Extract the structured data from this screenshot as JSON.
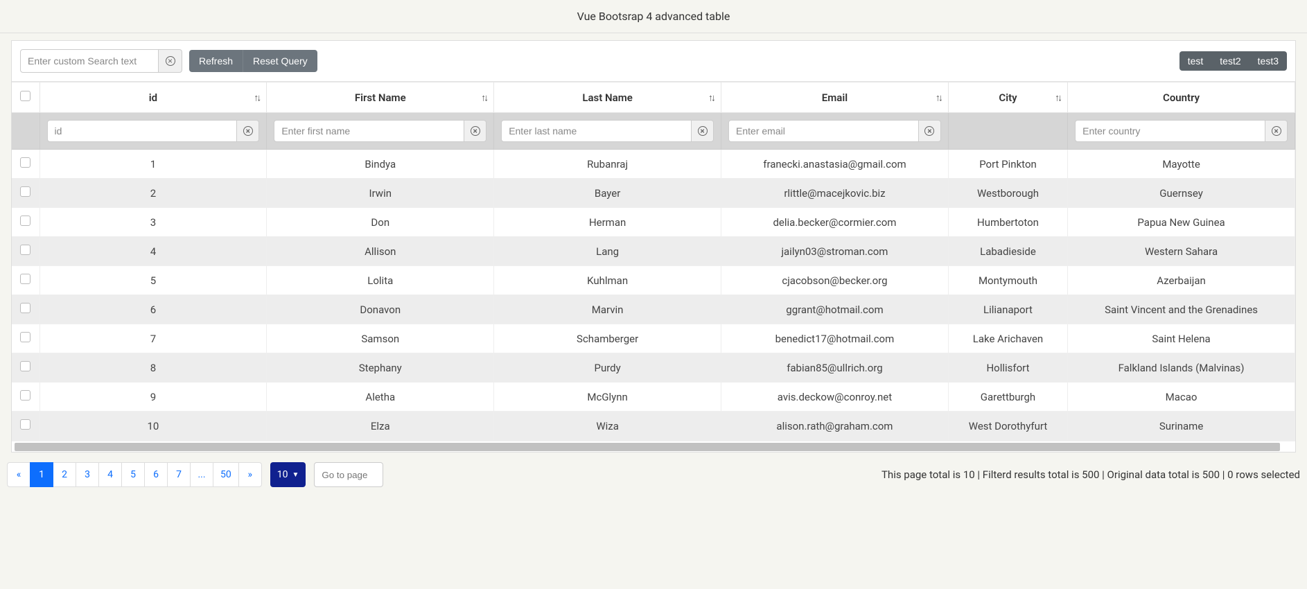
{
  "page_title": "Vue Bootsrap 4 advanced table",
  "toolbar": {
    "search_placeholder": "Enter custom Search text",
    "refresh_label": "Refresh",
    "reset_query_label": "Reset Query",
    "right_buttons": [
      "test",
      "test2",
      "test3"
    ]
  },
  "columns": [
    {
      "label": "id",
      "sortable": true,
      "filter_placeholder": "id"
    },
    {
      "label": "First Name",
      "sortable": true,
      "filter_placeholder": "Enter first name"
    },
    {
      "label": "Last Name",
      "sortable": true,
      "filter_placeholder": "Enter last name"
    },
    {
      "label": "Email",
      "sortable": true,
      "filter_placeholder": "Enter email"
    },
    {
      "label": "City",
      "sortable": true,
      "filter_placeholder": ""
    },
    {
      "label": "Country",
      "sortable": false,
      "filter_placeholder": "Enter country"
    }
  ],
  "rows": [
    {
      "id": "1",
      "first_name": "Bindya",
      "last_name": "Rubanraj",
      "email": "franecki.anastasia@gmail.com",
      "city": "Port Pinkton",
      "country": "Mayotte"
    },
    {
      "id": "2",
      "first_name": "Irwin",
      "last_name": "Bayer",
      "email": "rlittle@macejkovic.biz",
      "city": "Westborough",
      "country": "Guernsey"
    },
    {
      "id": "3",
      "first_name": "Don",
      "last_name": "Herman",
      "email": "delia.becker@cormier.com",
      "city": "Humbertoton",
      "country": "Papua New Guinea"
    },
    {
      "id": "4",
      "first_name": "Allison",
      "last_name": "Lang",
      "email": "jailyn03@stroman.com",
      "city": "Labadieside",
      "country": "Western Sahara"
    },
    {
      "id": "5",
      "first_name": "Lolita",
      "last_name": "Kuhlman",
      "email": "cjacobson@becker.org",
      "city": "Montymouth",
      "country": "Azerbaijan"
    },
    {
      "id": "6",
      "first_name": "Donavon",
      "last_name": "Marvin",
      "email": "ggrant@hotmail.com",
      "city": "Lilianaport",
      "country": "Saint Vincent and the Grenadines"
    },
    {
      "id": "7",
      "first_name": "Samson",
      "last_name": "Schamberger",
      "email": "benedict17@hotmail.com",
      "city": "Lake Arichaven",
      "country": "Saint Helena"
    },
    {
      "id": "8",
      "first_name": "Stephany",
      "last_name": "Purdy",
      "email": "fabian85@ullrich.org",
      "city": "Hollisfort",
      "country": "Falkland Islands (Malvinas)"
    },
    {
      "id": "9",
      "first_name": "Aletha",
      "last_name": "McGlynn",
      "email": "avis.deckow@conroy.net",
      "city": "Garettburgh",
      "country": "Macao"
    },
    {
      "id": "10",
      "first_name": "Elza",
      "last_name": "Wiza",
      "email": "alison.rath@graham.com",
      "city": "West Dorothyfurt",
      "country": "Suriname"
    }
  ],
  "pagination": {
    "prev": "«",
    "next": "»",
    "items": [
      "1",
      "2",
      "3",
      "4",
      "5",
      "6",
      "7",
      "...",
      "50"
    ],
    "active_index": 0,
    "per_page_label": "10",
    "goto_placeholder": "Go to page"
  },
  "footer_status": "This page total is 10 | Filterd results total is 500 | Original data total is 500 | 0 rows selected"
}
